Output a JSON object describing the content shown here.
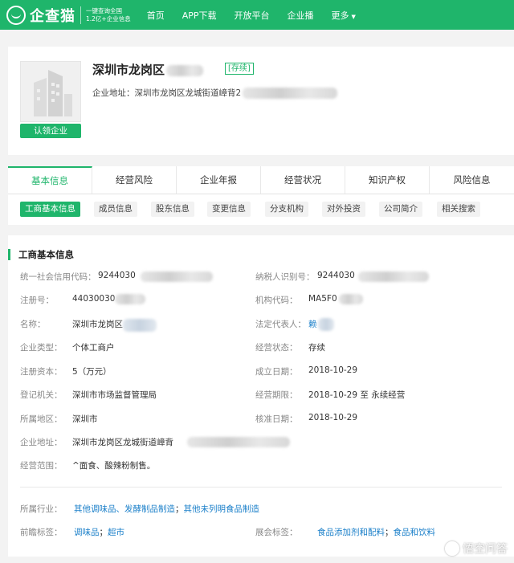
{
  "topbar": {
    "brand": "企查猫",
    "tagline_1": "一键查询全国",
    "tagline_2": "1.2亿+企业信息",
    "nav": [
      "首页",
      "APP下载",
      "开放平台",
      "企业播",
      "更多"
    ],
    "accent": "#1fb56b"
  },
  "header": {
    "company_name": "深圳市龙岗区",
    "status": "[存续]",
    "address": "企业地址：深圳市龙岗区龙城街道嶂背2",
    "claim_button": "认领企业"
  },
  "tabs": [
    "基本信息",
    "经营风险",
    "企业年报",
    "经营状况",
    "知识产权",
    "风险信息"
  ],
  "subtabs": [
    "工商基本信息",
    "成员信息",
    "股东信息",
    "变更信息",
    "分支机构",
    "对外投资",
    "公司简介",
    "相关搜索"
  ],
  "info": {
    "title": "工商基本信息",
    "left": [
      {
        "label": "统一社会信用代码：",
        "value": "9244030"
      },
      {
        "label": "注册号：",
        "value": "44030030"
      },
      {
        "label": "名称：",
        "value": "深圳市龙岗区"
      },
      {
        "label": "企业类型：",
        "value": "个体工商户"
      },
      {
        "label": "注册资本：",
        "value": "5（万元）"
      },
      {
        "label": "登记机关：",
        "value": "深圳市市场监督管理局"
      },
      {
        "label": "所属地区：",
        "value": "深圳市"
      },
      {
        "label": "企业地址：",
        "value": "深圳市龙岗区龙城街道嶂背"
      },
      {
        "label": "经营范围：",
        "value": "^面食、酸辣粉制售。"
      }
    ],
    "right": [
      {
        "label": "纳税人识别号：",
        "value": "9244030"
      },
      {
        "label": "机构代码：",
        "value": "MA5F0"
      },
      {
        "label": "法定代表人：",
        "value": "赖"
      },
      {
        "label": "经营状态：",
        "value": "存续"
      },
      {
        "label": "成立日期：",
        "value": "2018-10-29"
      },
      {
        "label": "经营期限：",
        "value": "2018-10-29 至 永续经营"
      },
      {
        "label": "核准日期：",
        "value": "2018-10-29"
      }
    ],
    "industry_label": "所属行业：",
    "industry_1": "其他调味品、发酵制品制造",
    "industry_2": "其他未列明食品制造",
    "frontier_label": "前瞻标签：",
    "frontier_1": "调味品",
    "frontier_2": "超市",
    "expo_label": "展会标签：",
    "expo_1": "食品添加剂和配料",
    "expo_2": "食品和饮料",
    "sep": "；"
  },
  "watermark": "悟空问答"
}
